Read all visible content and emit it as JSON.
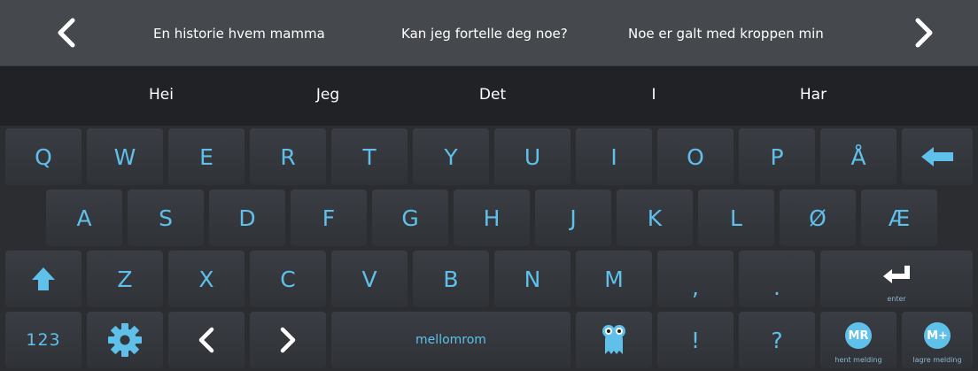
{
  "phrases": [
    "En historie hvem mamma",
    "Kan jeg fortelle deg noe?",
    "Noe er galt med kroppen min"
  ],
  "suggestions": [
    "Hei",
    "Jeg",
    "Det",
    "I",
    "Har"
  ],
  "keys": {
    "row1": [
      "Q",
      "W",
      "E",
      "R",
      "T",
      "Y",
      "U",
      "I",
      "O",
      "P",
      "Å"
    ],
    "row2": [
      "A",
      "S",
      "D",
      "F",
      "G",
      "H",
      "J",
      "K",
      "L",
      "Ø",
      "Æ"
    ],
    "row3": [
      "Z",
      "X",
      "C",
      "V",
      "B",
      "N",
      "M",
      ",",
      "."
    ],
    "numbers": "123",
    "space": "mellomrom",
    "exclaim": "!",
    "question": "?",
    "enter": "enter",
    "recall_badge": "MR",
    "recall_label": "hent melding",
    "save_badge": "M+",
    "save_label": "lagre melding"
  },
  "colors": {
    "accent": "#5fc0ea",
    "key_bg": "#34373c",
    "phrase_bar_bg": "#45484d",
    "suggest_bar_bg": "#202226"
  }
}
